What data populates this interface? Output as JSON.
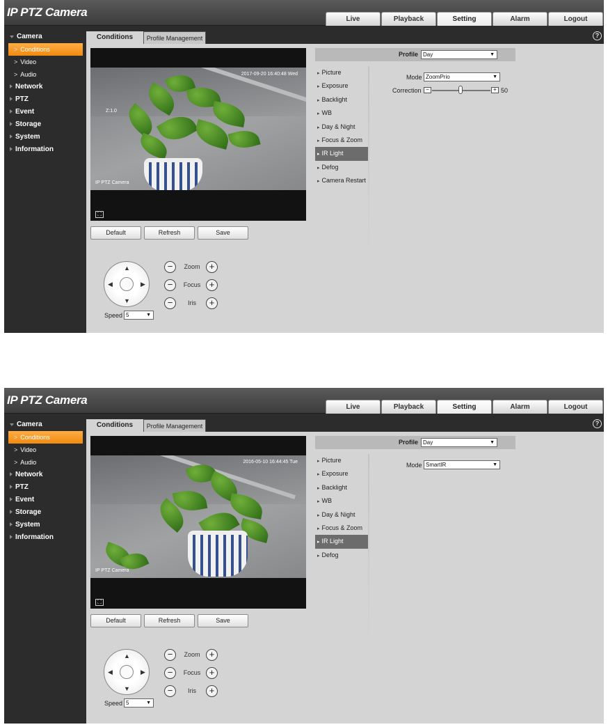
{
  "screens": [
    {
      "app_title": "IP PTZ Camera",
      "nav_tabs": [
        "Live",
        "Playback",
        "Setting",
        "Alarm",
        "Logout"
      ],
      "nav_active": "Setting",
      "help_glyph": "?",
      "sidebar": {
        "camera": "Camera",
        "conditions": "Conditions",
        "video": "Video",
        "audio": "Audio",
        "network": "Network",
        "ptz": "PTZ",
        "event": "Event",
        "storage": "Storage",
        "system": "System",
        "information": "Information"
      },
      "content_tabs": [
        "Conditions",
        "Profile Management"
      ],
      "video": {
        "timestamp": "2017-09-20 16:40:48 Wed",
        "zoom_osd": "Z:1.0",
        "channel_name": "IP PTZ Camera"
      },
      "buttons": {
        "default": "Default",
        "refresh": "Refresh",
        "save": "Save"
      },
      "ptz": {
        "zoom": "Zoom",
        "focus": "Focus",
        "iris": "Iris",
        "speed_label": "Speed",
        "speed_value": "5"
      },
      "profile": {
        "label": "Profile",
        "value": "Day"
      },
      "menu": [
        "Picture",
        "Exposure",
        "Backlight",
        "WB",
        "Day & Night",
        "Focus & Zoom",
        "IR Light",
        "Defog",
        "Camera Restart"
      ],
      "menu_active": "IR Light",
      "mode": {
        "label": "Mode",
        "value": "ZoomPrio"
      },
      "correction": {
        "label": "Correction",
        "value": 50
      }
    },
    {
      "app_title": "IP PTZ Camera",
      "nav_tabs": [
        "Live",
        "Playback",
        "Setting",
        "Alarm",
        "Logout"
      ],
      "nav_active": "Setting",
      "help_glyph": "?",
      "sidebar": {
        "camera": "Camera",
        "conditions": "Conditions",
        "video": "Video",
        "audio": "Audio",
        "network": "Network",
        "ptz": "PTZ",
        "event": "Event",
        "storage": "Storage",
        "system": "System",
        "information": "Information"
      },
      "content_tabs": [
        "Conditions",
        "Profile Management"
      ],
      "video": {
        "timestamp": "2016-05-10 16:44:45 Tue",
        "channel_name": "IP PTZ Camera"
      },
      "buttons": {
        "default": "Default",
        "refresh": "Refresh",
        "save": "Save"
      },
      "ptz": {
        "zoom": "Zoom",
        "focus": "Focus",
        "iris": "Iris",
        "speed_label": "Speed",
        "speed_value": "5"
      },
      "profile": {
        "label": "Profile",
        "value": "Day"
      },
      "menu": [
        "Picture",
        "Exposure",
        "Backlight",
        "WB",
        "Day & Night",
        "Focus & Zoom",
        "IR Light",
        "Defog"
      ],
      "menu_active": "IR Light",
      "mode": {
        "label": "Mode",
        "value": "SmartIR"
      }
    }
  ],
  "colors": {
    "sidebar_bg": "#2c2c2c",
    "content_bg": "#d4d4d4",
    "accent_orange": "#f08a10",
    "menu_active_bg": "#6c6c6c"
  },
  "icons": [
    "help-icon",
    "fullscreen-icon",
    "pan-up-icon",
    "pan-down-icon",
    "pan-left-icon",
    "pan-right-icon",
    "minus-icon",
    "plus-icon",
    "dropdown-caret-icon",
    "chevron-right-icon"
  ]
}
